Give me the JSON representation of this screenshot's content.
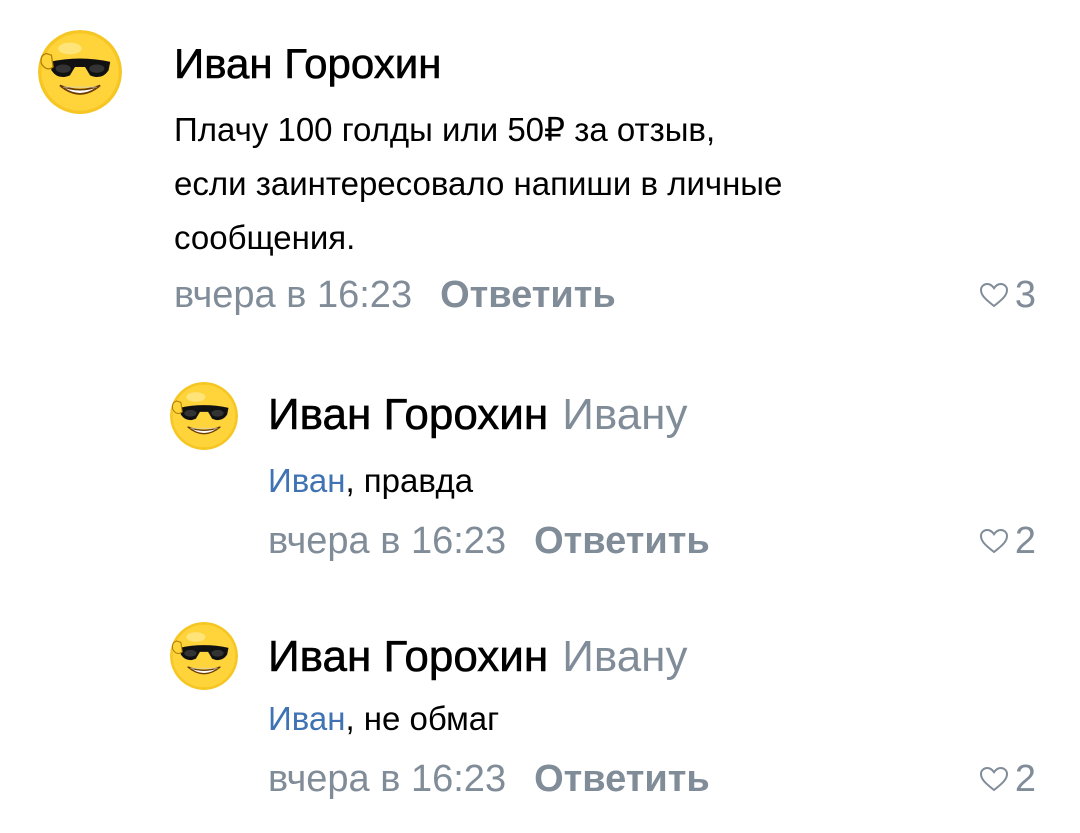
{
  "colors": {
    "text": "#000000",
    "secondary": "#818c99",
    "mention": "#3f73b3",
    "avatar_face": "#f6c624",
    "background": "#ffffff"
  },
  "comments": [
    {
      "author": "Иван Горохин",
      "reply_to": "",
      "text_lines": [
        "Плачу 100 голды или 50₽ за отзыв,",
        "если заинтересовало напиши в личные",
        "сообщения."
      ],
      "time": "вчера в 16:23",
      "reply_label": "Ответить",
      "likes": "3",
      "avatar_icon": "smiley-sunglasses-avatar"
    },
    {
      "author": "Иван Горохин",
      "reply_to": "Ивану",
      "mention": "Иван",
      "text_rest": ", правда",
      "time": "вчера в 16:23",
      "reply_label": "Ответить",
      "likes": "2",
      "avatar_icon": "smiley-sunglasses-avatar"
    },
    {
      "author": "Иван Горохин",
      "reply_to": "Ивану",
      "mention": "Иван",
      "text_rest": ", не обмаг",
      "time": "вчера в 16:23",
      "reply_label": "Ответить",
      "likes": "2",
      "avatar_icon": "smiley-sunglasses-avatar"
    }
  ]
}
